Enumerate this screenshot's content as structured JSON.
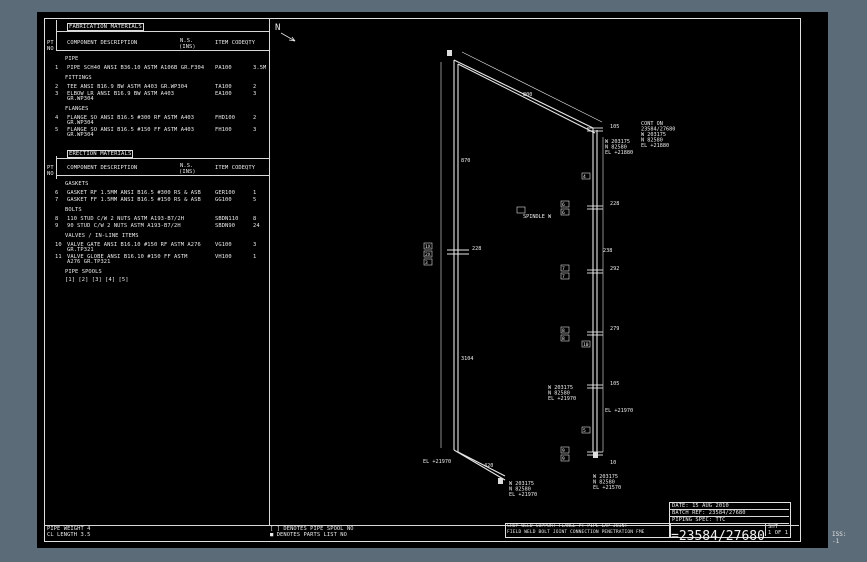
{
  "parts_list": {
    "section_fab": "FABRICATION MATERIALS",
    "section_erect": "ERECTION MATERIALS",
    "col_pt": "PT",
    "col_no": "NO",
    "col_component": "COMPONENT DESCRIPTION",
    "col_ns": "N.S.",
    "col_ins": "(INS)",
    "col_item": "ITEM CODE",
    "col_qty": "QTY",
    "groups": [
      {
        "title": "PIPE",
        "rows": [
          {
            "pt": "1",
            "desc": [
              "PIPE SCH40 ANSI B36.10 ASTM A106B GR.F304"
            ],
            "item": "PA100",
            "qty": "3.5M"
          }
        ]
      },
      {
        "title": "FITTINGS",
        "rows": [
          {
            "pt": "2",
            "desc": [
              "TEE ANSI B16.9 BW ASTM A403 GR.WP304"
            ],
            "item": "TA100",
            "qty": "2"
          },
          {
            "pt": "3",
            "desc": [
              "ELBOW LR ANSI B16.9 BW ASTM A403",
              "GR.WP304"
            ],
            "item": "EA100",
            "qty": "3"
          }
        ]
      },
      {
        "title": "FLANGES",
        "rows": [
          {
            "pt": "4",
            "desc": [
              "FLANGE SO ANSI B16.5 #300 RF ASTM A403",
              "GR.WP304"
            ],
            "item": "FHD100",
            "qty": "2"
          },
          {
            "pt": "5",
            "desc": [
              "FLANGE SO ANSI B16.5 #150 FF ASTM A403",
              "GR.WP304"
            ],
            "item": "FH100",
            "qty": "3"
          }
        ]
      }
    ],
    "erect_groups": [
      {
        "title": "GASKETS",
        "rows": [
          {
            "pt": "6",
            "desc": [
              "GASKET RF 1.5MM ANSI B16.5 #300 RS & ASB"
            ],
            "item": "GER100",
            "qty": "1"
          },
          {
            "pt": "7",
            "desc": [
              "GASKET FF 1.5MM ANSI B16.5 #150 RS & ASB"
            ],
            "item": "GG100",
            "qty": "5"
          }
        ]
      },
      {
        "title": "BOLTS",
        "rows": [
          {
            "pt": "8",
            "desc": [
              "110 STUD C/W 2 NUTS ASTM A193-B7/2H"
            ],
            "item": "SBDN110",
            "qty": "8"
          },
          {
            "pt": "9",
            "desc": [
              "90 STUD C/W 2 NUTS ASTM A193-B7/2H"
            ],
            "item": "SBDN90",
            "qty": "24"
          }
        ]
      },
      {
        "title": "VALVES / IN-LINE ITEMS",
        "rows": [
          {
            "pt": "10",
            "desc": [
              "VALVE GATE ANSI B16.10 #150 RF ASTM A276",
              "GR.TP321"
            ],
            "item": "VG100",
            "qty": "3"
          },
          {
            "pt": "11",
            "desc": [
              "VALVE GLOBE ANSI B16.10 #150 FF ASTM",
              "A276 GR.TP321"
            ],
            "item": "VH100",
            "qty": "1"
          }
        ]
      }
    ],
    "spools_title": "PIPE SPOOLS",
    "spools": "[1] [2] [3] [4] [5]"
  },
  "footer": {
    "pipe_weight": "PIPE WEIGHT  4",
    "cl_length": "CL LENGTH  3.5",
    "note1": "[ ] DENOTES PIPE SPOOL NO",
    "note2": "■ DENOTES PARTS LIST NO",
    "leg1": "SHOP WELD  SUPPORT  FLANGE  PT  PIPE  LAP JOINT",
    "leg2": "FIELD WELD  BOLT  JOINT  CONNECTION  PENETRATION  FME",
    "date": "DATE: 15 AUG 2010",
    "batch": "BATCH REF: 23584/27680",
    "spec": "PIPING SPEC: TTC",
    "drawing_no": "=23584/27680",
    "sheet1": "SHT",
    "sheet2": "1 OF 1",
    "iss": "ISS: -1"
  },
  "iso": {
    "north": "N",
    "dims": [
      "800",
      "870",
      "105",
      "228",
      "292",
      "279",
      "105",
      "10",
      "3104",
      "238",
      "420"
    ],
    "conn_top": [
      "CONT ON",
      "23584/27680",
      "W 203175",
      "N 82580",
      "EL +21880"
    ],
    "conn_top2": [
      "W 203175",
      "N 82580",
      "EL +21880"
    ],
    "mid_coord": [
      "W 203175",
      "N 82580",
      "EL +21970"
    ],
    "mid_el": "EL +21970",
    "bot_left": "EL +21970",
    "bot_mid": [
      "W 203175",
      "N 82580",
      "EL +21970"
    ],
    "bot_right": [
      "W 203175",
      "N 82580",
      "EL +21570"
    ],
    "spindle": "SPINDLE W",
    "tags": [
      "1X",
      "2X",
      "3",
      "4",
      "5",
      "6",
      "7",
      "8",
      "9",
      "10",
      "11"
    ]
  }
}
